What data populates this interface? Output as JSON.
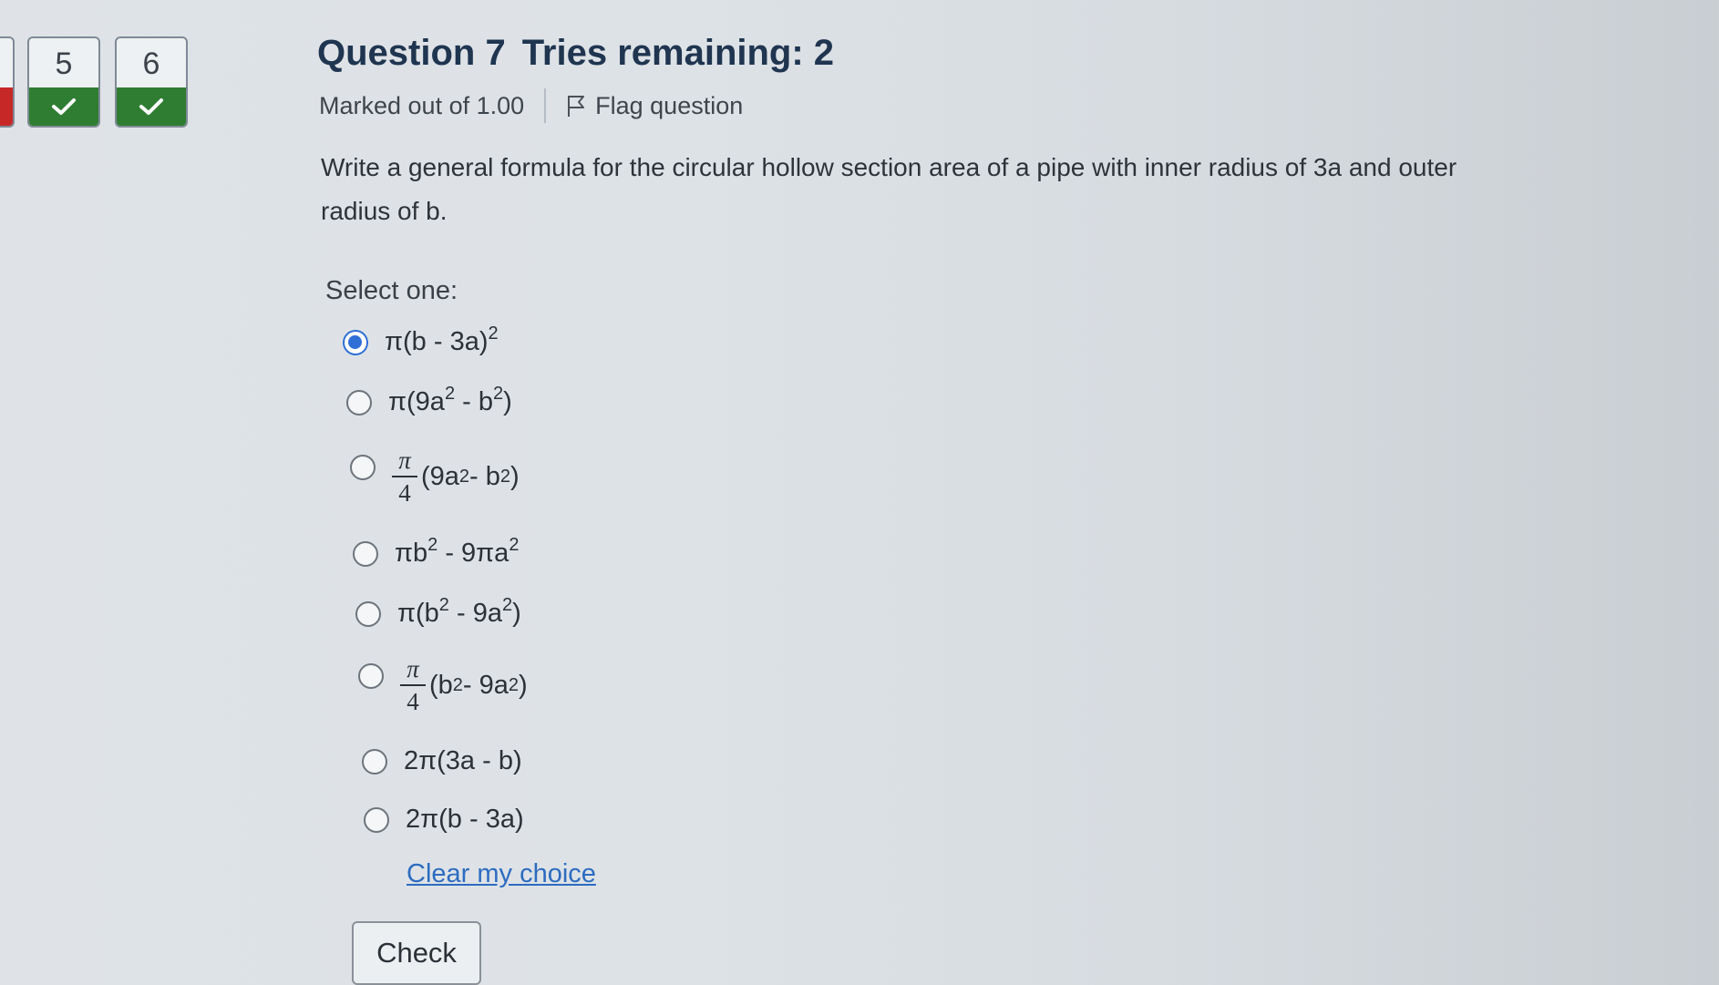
{
  "nav": {
    "tiles": [
      {
        "number": "5",
        "status": "correct"
      },
      {
        "number": "6",
        "status": "correct"
      }
    ]
  },
  "question": {
    "number_label": "Question 7",
    "tries_label": "Tries remaining: 2",
    "marked_out": "Marked out of 1.00",
    "flag_label": "Flag question",
    "text": "Write a general formula for the circular hollow section area of a pipe with inner radius of 3a and outer radius of b.",
    "select_prompt": "Select one:"
  },
  "options": [
    {
      "label": "π(b - 3a)²",
      "selected": true
    },
    {
      "label": "π(9a² - b²)",
      "selected": false
    },
    {
      "label": "π/4 (9a² - b²)",
      "selected": false
    },
    {
      "label": "πb² - 9πa²",
      "selected": false
    },
    {
      "label": "π(b² - 9a²)",
      "selected": false
    },
    {
      "label": "π/4 (b² - 9a²)",
      "selected": false
    },
    {
      "label": "2π(3a - b)",
      "selected": false
    },
    {
      "label": "2π(b - 3a)",
      "selected": false
    }
  ],
  "actions": {
    "clear_label": "Clear my choice",
    "check_label": "Check"
  },
  "colors": {
    "correct": "#2f7d32",
    "incorrect": "#c62828",
    "selected_radio": "#2f6fd6",
    "link": "#2d6cc0",
    "title": "#1f3550"
  }
}
